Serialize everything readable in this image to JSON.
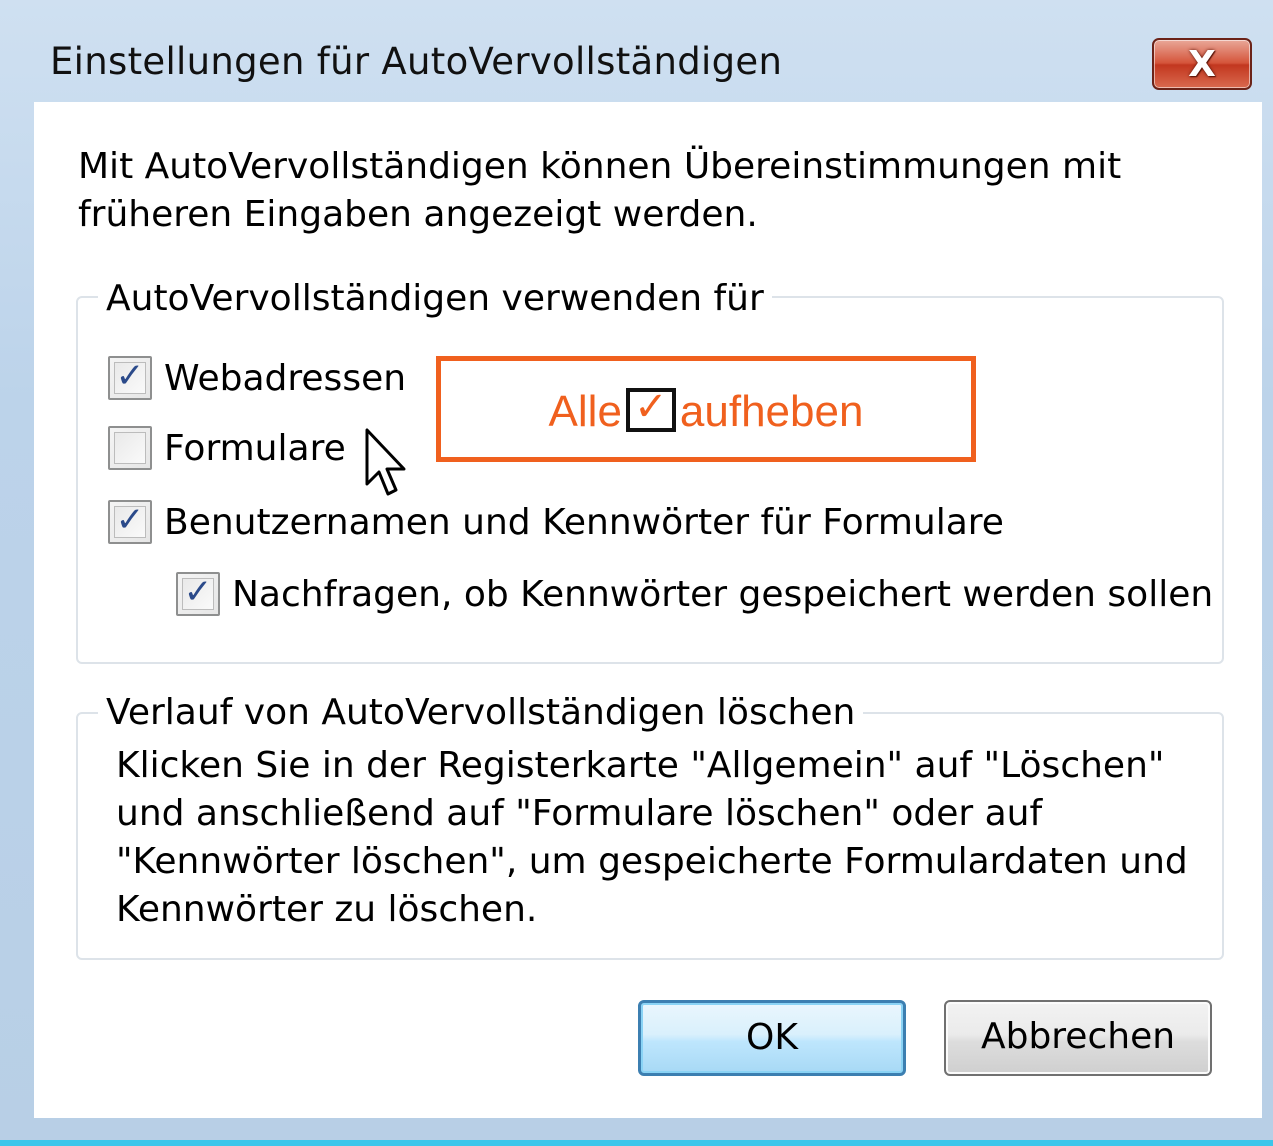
{
  "window": {
    "title": "Einstellungen für AutoVervollständigen",
    "close_symbol": "X"
  },
  "intro_text": "Mit AutoVervollständigen können Übereinstimmungen mit früheren Eingaben angezeigt werden.",
  "use_group": {
    "legend": "AutoVervollständigen verwenden für",
    "items": [
      {
        "label": "Webadressen",
        "checked": true
      },
      {
        "label": "Formulare",
        "checked": false
      },
      {
        "label": "Benutzernamen und Kennwörter für Formulare",
        "checked": true
      },
      {
        "label": "Nachfragen, ob Kennwörter gespeichert werden sollen",
        "checked": true
      }
    ]
  },
  "annotation": {
    "text_before": "Alle",
    "check_symbol": "✓",
    "text_after": "aufheben",
    "color": "#f0601e"
  },
  "clear_group": {
    "legend": "Verlauf von AutoVervollständigen löschen",
    "lines": [
      "Klicken Sie in der Registerkarte \"Allgemein\" auf \"Löschen\"",
      "und anschließend auf \"Formulare löschen\" oder auf",
      "\"Kennwörter löschen\", um gespeicherte Formulardaten und",
      "Kennwörter zu löschen."
    ]
  },
  "buttons": {
    "ok": "OK",
    "cancel": "Abbrechen"
  },
  "checkmark_symbol": "✓",
  "icons": [
    "close-icon",
    "checkbox-check-icon",
    "mouse-pointer-icon"
  ]
}
